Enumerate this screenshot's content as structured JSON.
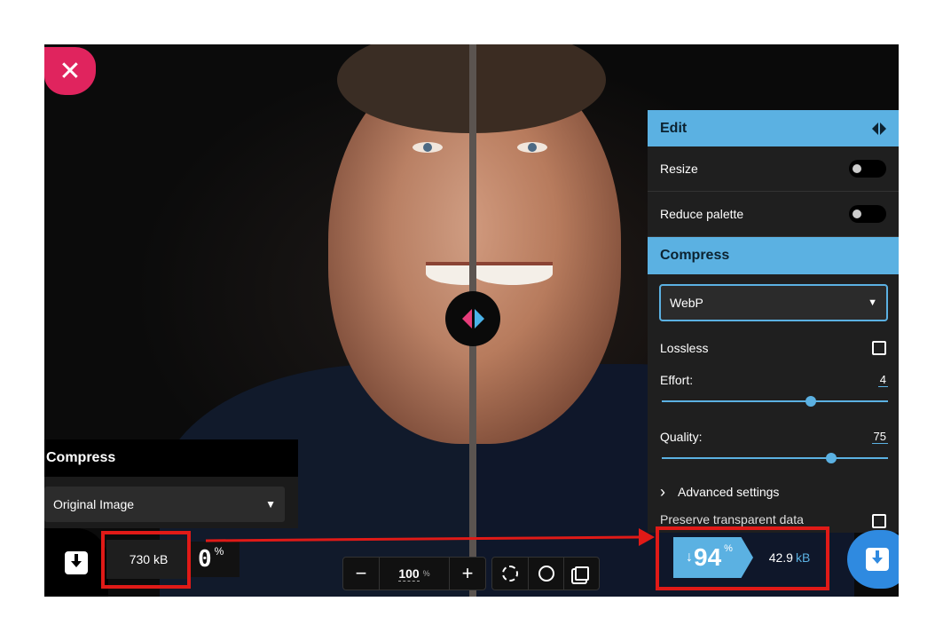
{
  "close": {
    "symbol": "✕"
  },
  "left_panel": {
    "title": "Compress",
    "select_value": "Original Image",
    "chevron": "⌄"
  },
  "original": {
    "size": "730 kB",
    "percent": "0",
    "percent_sign": "%"
  },
  "toolbar": {
    "minus": "−",
    "zoom": "100",
    "zoom_unit": "%",
    "plus": "+"
  },
  "edit_panel": {
    "title": "Edit",
    "resize_label": "Resize",
    "reduce_palette_label": "Reduce palette",
    "compress_title": "Compress",
    "format_value": "WebP",
    "lossless_label": "Lossless",
    "effort_label": "Effort:",
    "effort_value": "4",
    "effort_fraction": 0.66,
    "quality_label": "Quality:",
    "quality_value": "75",
    "quality_fraction": 0.75,
    "advanced_label": "Advanced settings",
    "advanced_chevron": "›",
    "preserve_label": "Preserve transparent data"
  },
  "result": {
    "arrow": "↓",
    "percent": "94",
    "percent_sign": "%",
    "size_number": "42.9",
    "size_unit": "kB"
  },
  "colors": {
    "accent_blue": "#5bb1e2",
    "close_pink": "#e0245e",
    "annotation_red": "#e01a17"
  }
}
